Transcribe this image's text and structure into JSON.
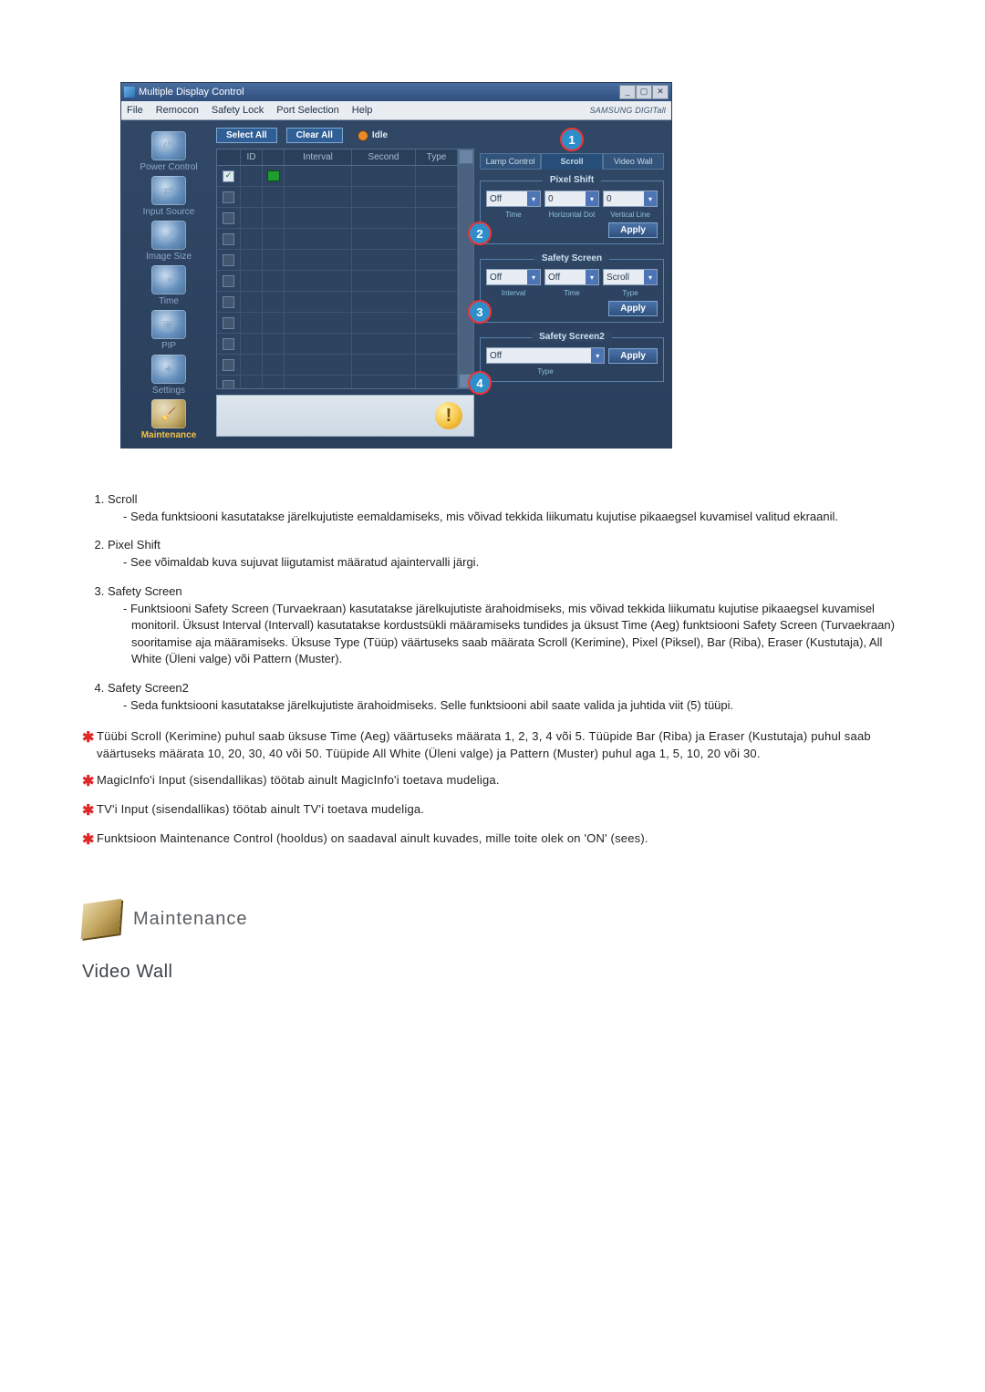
{
  "window": {
    "title": "Multiple Display Control",
    "menu": [
      "File",
      "Remocon",
      "Safety Lock",
      "Port Selection",
      "Help"
    ],
    "brand": "SAMSUNG DIGITall"
  },
  "sidebar": [
    {
      "label": "Power Control"
    },
    {
      "label": "Input Source"
    },
    {
      "label": "Image Size"
    },
    {
      "label": "Time"
    },
    {
      "label": "PIP"
    },
    {
      "label": "Settings"
    },
    {
      "label": "Maintenance",
      "active": true
    }
  ],
  "toolbar": {
    "select_all": "Select All",
    "clear_all": "Clear All",
    "idle": "Idle"
  },
  "grid_headers": [
    "",
    "ID",
    "",
    "Interval",
    "Second",
    "Type"
  ],
  "right": {
    "tabs": [
      "Lamp Control",
      "Scroll",
      "Video Wall"
    ],
    "callouts": {
      "n1": "1",
      "n2": "2",
      "n3": "3",
      "n4": "4"
    },
    "pixel_shift": {
      "title": "Pixel Shift",
      "time_val": "Off",
      "hdot_val": "0",
      "vline_val": "0",
      "time_lbl": "Time",
      "hdot_lbl": "Horizontal Dot",
      "vline_lbl": "Vertical Line",
      "apply": "Apply"
    },
    "safety_screen": {
      "title": "Safety Screen",
      "interval_val": "Off",
      "time_val": "Off",
      "type_val": "Scroll",
      "interval_lbl": "Interval",
      "time_lbl": "Time",
      "type_lbl": "Type",
      "apply": "Apply"
    },
    "safety_screen2": {
      "title": "Safety Screen2",
      "type_val": "Off",
      "type_lbl": "Type",
      "apply": "Apply"
    }
  },
  "explain": {
    "items": [
      {
        "title": "Scroll",
        "body": "- Seda funktsiooni kasutatakse järelkujutiste eemaldamiseks, mis võivad tekkida liikumatu kujutise pikaaegsel kuvamisel valitud ekraanil."
      },
      {
        "title": "Pixel Shift",
        "body": "- See võimaldab kuva sujuvat liigutamist määratud ajaintervalli järgi."
      },
      {
        "title": "Safety Screen",
        "body": "- Funktsiooni Safety Screen (Turvaekraan) kasutatakse järelkujutiste ärahoidmiseks, mis võivad tekkida liikumatu kujutise pikaaegsel kuvamisel monitoril.  Üksust Interval (Intervall) kasutatakse kordustsükli määramiseks tundides ja üksust Time (Aeg) funktsiooni Safety Screen (Turvaekraan) sooritamise aja määramiseks. Üksuse Type (Tüüp) väärtuseks saab määrata Scroll (Kerimine), Pixel (Piksel), Bar (Riba), Eraser (Kustutaja), All White (Üleni valge) või Pattern (Muster)."
      },
      {
        "title": "Safety Screen2",
        "body": "- Seda funktsiooni kasutatakse järelkujutiste ärahoidmiseks. Selle funktsiooni abil saate valida ja juhtida viit (5) tüüpi."
      }
    ],
    "notes": [
      "Tüübi Scroll (Kerimine) puhul saab üksuse Time (Aeg) väärtuseks määrata 1, 2, 3, 4 või 5. Tüüpide Bar (Riba) ja Eraser (Kustutaja) puhul saab väärtuseks määrata 10, 20, 30, 40 või 50. Tüüpide All White (Üleni valge) ja Pattern (Muster) puhul aga 1, 5, 10, 20 või 30.",
      "MagicInfo'i Input (sisendallikas) töötab ainult MagicInfo'i toetava mudeliga.",
      "TV'i Input (sisendallikas) töötab ainult TV'i toetava mudeliga.",
      "Funktsioon Maintenance Control (hooldus) on saadaval ainult kuvades, mille toite olek on 'ON' (sees)."
    ]
  },
  "section": {
    "title": "Maintenance",
    "sub": "Video Wall"
  }
}
